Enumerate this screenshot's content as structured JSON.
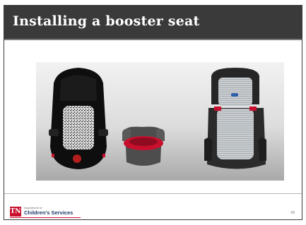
{
  "slide": {
    "title": "Installing a booster seat",
    "photo_alt": "Three child booster seats",
    "page_number": "68"
  },
  "footer": {
    "logo_text": "TN",
    "department_label": "Department of",
    "department_name": "Children's Services"
  },
  "colors": {
    "header_bg": "#3a3a3a",
    "title_text": "#ffffff",
    "logo_red": "#c8102e",
    "dept_blue": "#1f3a68"
  }
}
